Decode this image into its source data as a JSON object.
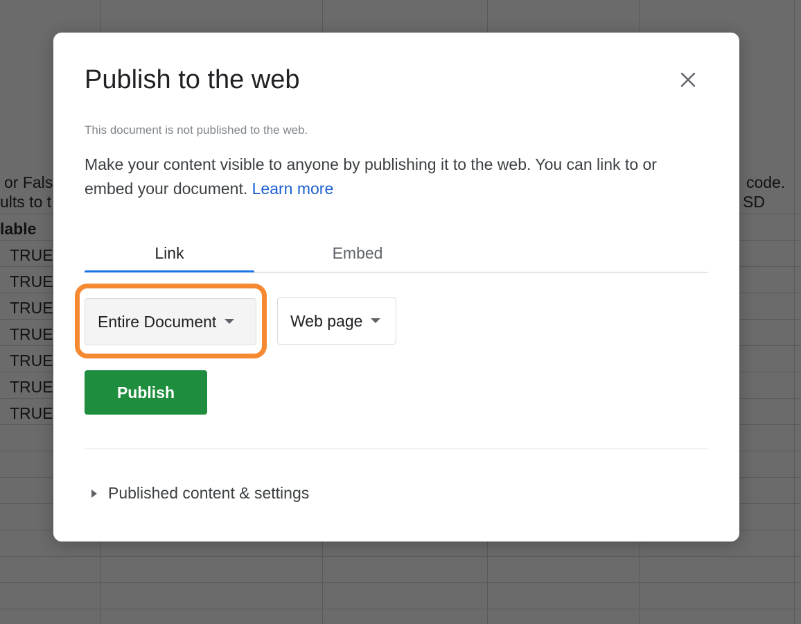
{
  "background_sheet": {
    "cells": [
      {
        "id": "c1",
        "text": "or Fals"
      },
      {
        "id": "c2",
        "text": "ults to t"
      },
      {
        "id": "c3",
        "text": "lable"
      },
      {
        "id": "c4",
        "text": "TRUE"
      },
      {
        "id": "c5",
        "text": "TRUE"
      },
      {
        "id": "c6",
        "text": "TRUE"
      },
      {
        "id": "c7",
        "text": "TRUE"
      },
      {
        "id": "c8",
        "text": "TRUE"
      },
      {
        "id": "c9",
        "text": "TRUE"
      },
      {
        "id": "c10",
        "text": "TRUE"
      },
      {
        "id": "c11",
        "text": "code."
      },
      {
        "id": "c12",
        "text": "SD"
      }
    ]
  },
  "dialog": {
    "title": "Publish to the web",
    "close_icon": "close-icon",
    "status_text": "This document is not published to the web.",
    "description": "Make your content visible to anyone by publishing it to the web. You can link to or embed your document.",
    "learn_more": "Learn more",
    "tabs": [
      {
        "label": "Link",
        "active": true
      },
      {
        "label": "Embed",
        "active": false
      }
    ],
    "scope_dropdown": {
      "selected": "Entire Document",
      "icon": "caret-down-icon"
    },
    "format_dropdown": {
      "selected": "Web page",
      "icon": "caret-down-icon"
    },
    "publish_button": "Publish",
    "expander": {
      "label": "Published content & settings",
      "icon": "triangle-right-icon"
    },
    "colors": {
      "accent": "#1a73e8",
      "publish": "#1e8e3e",
      "highlight": "#f68a33",
      "link": "#1a5fd1"
    }
  }
}
